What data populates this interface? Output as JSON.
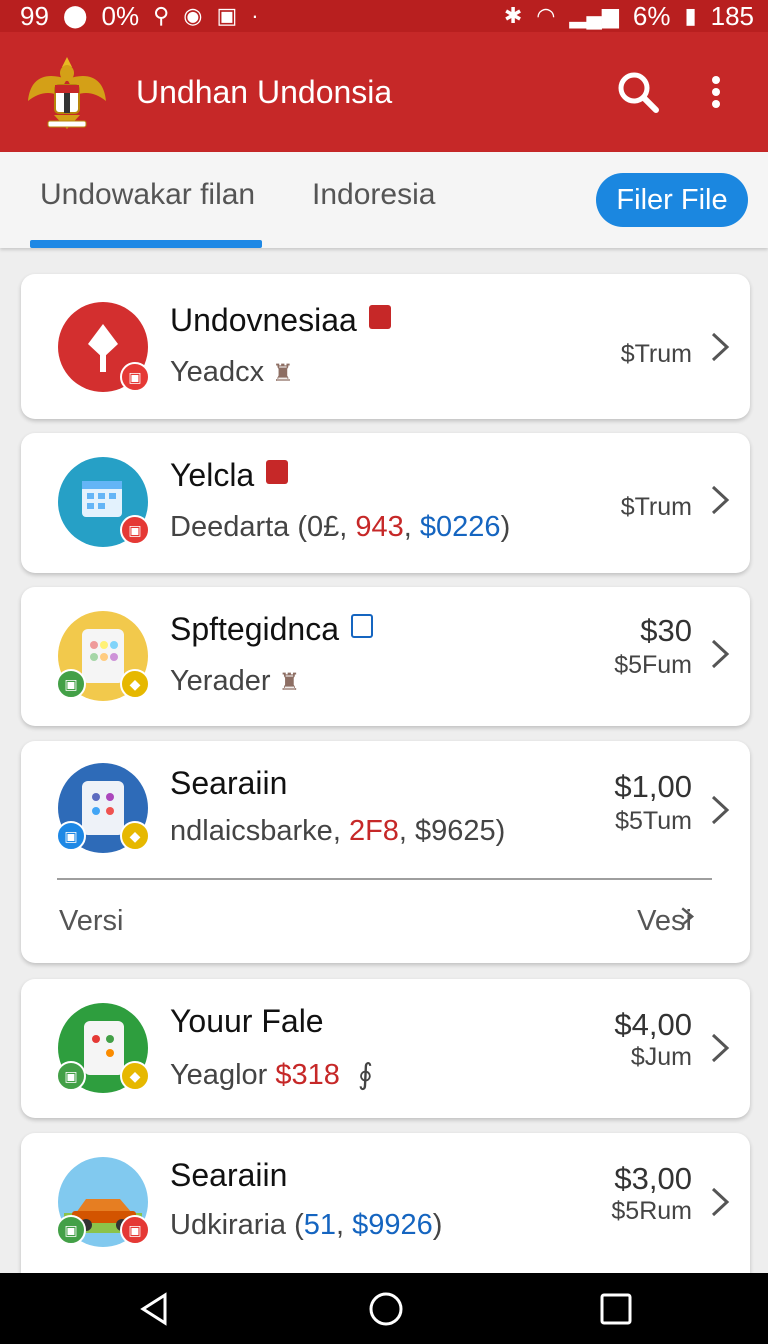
{
  "status_bar": {
    "left": [
      "99",
      "0%"
    ],
    "battery": "6%",
    "right_text": "185"
  },
  "app_bar": {
    "title": "Undhan Undonsia",
    "emblem_icon": "garuda-emblem-icon",
    "actions": [
      "search-icon",
      "more-vert-icon"
    ]
  },
  "tabs": [
    {
      "label": "Undowakar filan",
      "active": true
    },
    {
      "label": "Indoresia",
      "active": false
    }
  ],
  "filter_button": {
    "label": "Filer File"
  },
  "items": [
    {
      "title": "Undovnesiaa",
      "subtitle": "Yeadcx",
      "price": "",
      "price_sub": "$Trum"
    },
    {
      "title": "Yelcla",
      "subtitle_parts": [
        "Deedarta (0£, ",
        "943",
        ", ",
        "$0226",
        ")"
      ],
      "price": "",
      "price_sub": "$Trum"
    },
    {
      "title": "Spftegidnca",
      "subtitle": "Yerader",
      "price": "$30",
      "price_sub": "$5Fum"
    },
    {
      "title": "Searaiin",
      "subtitle_parts": [
        "ndlaicsbarke, ",
        "2F8",
        ", $9625)"
      ],
      "price": "$1,00",
      "price_sub": "$5Tum",
      "footer": {
        "left": "Versi",
        "right": "Vesi"
      }
    },
    {
      "title": "Youur Fale",
      "subtitle_parts": [
        "Yeaglor ",
        "$318"
      ],
      "price": "$4,00",
      "price_sub": "$Jum"
    },
    {
      "title": "Searaiin",
      "subtitle_parts": [
        "Udkiraria (",
        "51",
        ", ",
        "$9926",
        ")"
      ],
      "price": "$3,00",
      "price_sub": "$5Rum"
    }
  ],
  "colors": {
    "primary": "#c62828",
    "accent": "#1b87e0",
    "tag_red": "#c62828",
    "tag_blue": "#1565c0"
  },
  "nav_bar": [
    "back-icon",
    "home-icon",
    "recents-icon"
  ]
}
